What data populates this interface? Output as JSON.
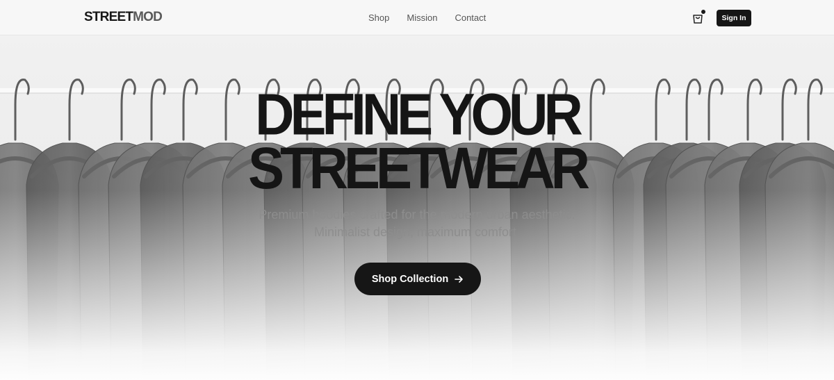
{
  "brand": {
    "part1": "STREET",
    "part2": "MOD"
  },
  "nav": {
    "items": [
      "Shop",
      "Mission",
      "Contact"
    ]
  },
  "header": {
    "signin_label": "Sign In",
    "cart_icon": "shopping-bag-icon"
  },
  "hero": {
    "headline_line1": "DEFINE YOUR",
    "headline_line2": "STREETWEAR",
    "subtitle_line1": "Premium hoodies crafted for the modern urban aesthetic.",
    "subtitle_line2": "Minimalist design, maximum comfort.",
    "cta_label": "Shop Collection",
    "cta_icon": "arrow-right-icon"
  },
  "colors": {
    "primary": "#161616",
    "muted_text": "#8d8d8d",
    "nav_text": "#555555"
  }
}
